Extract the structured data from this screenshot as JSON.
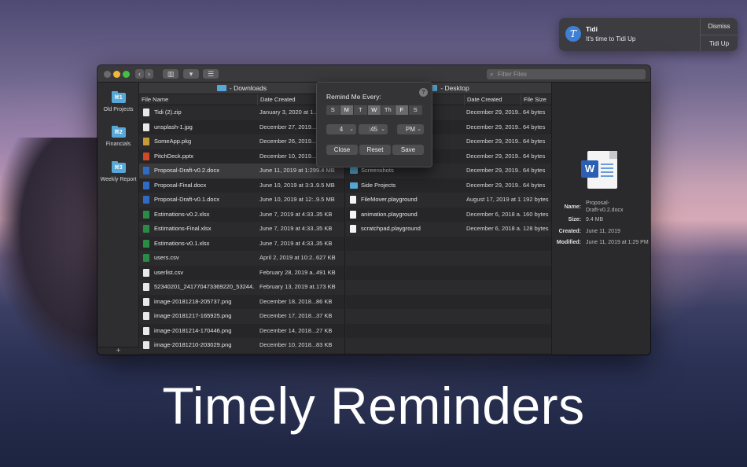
{
  "notification": {
    "app": "Tidi",
    "message": "It's time to Tidi Up",
    "dismiss": "Dismiss",
    "action": "Tidi Up"
  },
  "toolbar": {
    "filter_placeholder": "Filter Files",
    "back": "‹",
    "forward": "›"
  },
  "sidebar": {
    "items": [
      {
        "shortcut": "⌘1",
        "label": "Old Projects"
      },
      {
        "shortcut": "⌘2",
        "label": "Financials"
      },
      {
        "shortcut": "⌘3",
        "label": "Weekly Report"
      }
    ],
    "add": "+"
  },
  "left_pane": {
    "title": "- Downloads",
    "columns": [
      "File Name",
      "Date Created"
    ],
    "rows": [
      {
        "icon": "zip",
        "name": "Tidi (2).zip",
        "date": "January 3, 2020 at 1...",
        "size": ""
      },
      {
        "icon": "file",
        "name": "unsplash-1.jpg",
        "date": "December 27, 2019...",
        "size": ""
      },
      {
        "icon": "pkg",
        "name": "SomeApp.pkg",
        "date": "December 26, 2019...",
        "size": ""
      },
      {
        "icon": "ppt",
        "name": "PitchDeck.pptx",
        "date": "December 10, 2019...",
        "size": ""
      },
      {
        "icon": "doc",
        "name": "Proposal-Draft-v0.2.docx",
        "date": "June 11, 2019 at 1:29...",
        "size": "9.4 MB"
      },
      {
        "icon": "doc",
        "name": "Proposal-Final.docx",
        "date": "June 10, 2019 at 3:3...",
        "size": "9.5 MB"
      },
      {
        "icon": "doc",
        "name": "Proposal-Draft-v0.1.docx",
        "date": "June 10, 2019 at 12:...",
        "size": "9.5 MB"
      },
      {
        "icon": "xls",
        "name": "Estimations-v0.2.xlsx",
        "date": "June 7, 2019 at 4:33...",
        "size": "35 KB"
      },
      {
        "icon": "xls",
        "name": "Estimations-Final.xlsx",
        "date": "June 7, 2019 at 4:33...",
        "size": "35 KB"
      },
      {
        "icon": "xls",
        "name": "Estimations-v0.1.xlsx",
        "date": "June 7, 2019 at 4:33...",
        "size": "35 KB"
      },
      {
        "icon": "xls",
        "name": "users.csv",
        "date": "April 2, 2019 at 10:2...",
        "size": "627 KB"
      },
      {
        "icon": "file",
        "name": "userlist.csv",
        "date": "February 28, 2019 a...",
        "size": "491 KB"
      },
      {
        "icon": "file",
        "name": "52340201_241770473369220_53244...",
        "date": "February 13, 2019 at...",
        "size": "173 KB"
      },
      {
        "icon": "file",
        "name": "image-20181218-205737.png",
        "date": "December 18, 2018...",
        "size": "86 KB"
      },
      {
        "icon": "file",
        "name": "image-20181217-165925.png",
        "date": "December 17, 2018...",
        "size": "37 KB"
      },
      {
        "icon": "file",
        "name": "image-20181214-170446.png",
        "date": "December 14, 2018...",
        "size": "27 KB"
      },
      {
        "icon": "file",
        "name": "image-20181210-203029.png",
        "date": "December 10, 2018...",
        "size": "83 KB"
      }
    ]
  },
  "right_pane": {
    "title": "- Desktop",
    "columns": [
      "Date Created",
      "File Size"
    ],
    "rows": [
      {
        "icon": "",
        "name": "",
        "date": "December 29, 2019...",
        "size": "64 bytes"
      },
      {
        "icon": "",
        "name": "",
        "date": "December 29, 2019...",
        "size": "64 bytes"
      },
      {
        "icon": "",
        "name": "",
        "date": "December 29, 2019...",
        "size": "64 bytes"
      },
      {
        "icon": "",
        "name": "",
        "date": "December 29, 2019...",
        "size": "64 bytes"
      },
      {
        "icon": "folder",
        "name": "Screenshots",
        "date": "December 29, 2019...",
        "size": "64 bytes"
      },
      {
        "icon": "folder",
        "name": "Side Projects",
        "date": "December 29, 2019...",
        "size": "64 bytes"
      },
      {
        "icon": "pg",
        "name": "FileMover.playground",
        "date": "August 17, 2019 at 11...",
        "size": "192 bytes"
      },
      {
        "icon": "pg",
        "name": "animation.playground",
        "date": "December 6, 2018 a...",
        "size": "160 bytes"
      },
      {
        "icon": "pg",
        "name": "scratchpad.playground",
        "date": "December 6, 2018 a...",
        "size": "128 bytes"
      }
    ]
  },
  "preview": {
    "name_label": "Name:",
    "name_value_1": "Proposal-",
    "name_value_2": "Draft-v0.2.docx",
    "size_label": "Size:",
    "size_value": "9.4 MB",
    "created_label": "Created:",
    "created_value": "June 11, 2019",
    "modified_label": "Modified:",
    "modified_value": "June 11, 2019 at 1:29 PM"
  },
  "reminder": {
    "title": "Remind Me Every:",
    "help": "?",
    "days": [
      {
        "label": "S",
        "on": false
      },
      {
        "label": "M",
        "on": true
      },
      {
        "label": "T",
        "on": false
      },
      {
        "label": "W",
        "on": true
      },
      {
        "label": "Th",
        "on": false
      },
      {
        "label": "F",
        "on": true
      },
      {
        "label": "S",
        "on": false
      }
    ],
    "hour": "4",
    "minute": ":45",
    "ampm": "PM",
    "close": "Close",
    "reset": "Reset",
    "save": "Save"
  },
  "headline": "Timely Reminders"
}
